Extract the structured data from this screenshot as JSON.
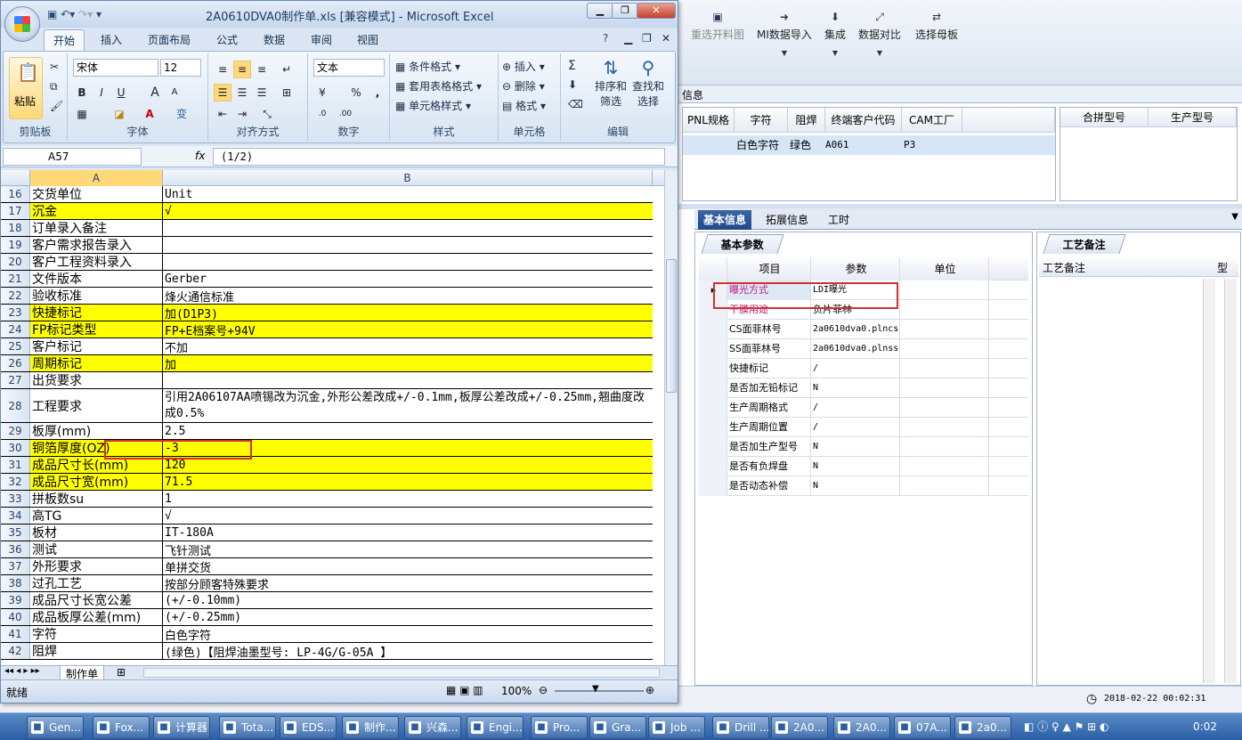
{
  "excel": {
    "title": "2A0610DVA0制作单.xls  [兼容模式] - Microsoft Excel",
    "tabs": [
      "开始",
      "插入",
      "页面布局",
      "公式",
      "数据",
      "审阅",
      "视图"
    ],
    "ribbon": {
      "paste": "粘贴",
      "clipboard": "剪贴板",
      "font_name": "宋体",
      "font_size": "12",
      "font": "字体",
      "bold": "B",
      "italic": "I",
      "underline": "U",
      "grow": "A",
      "shrink": "A",
      "wen": "变",
      "align": "对齐方式",
      "number_format": "文本",
      "number": "数字",
      "percent": "%",
      "comma": ",",
      "cond_format": "条件格式",
      "table_format": "套用表格格式",
      "cell_style": "单元格样式",
      "styles": "样式",
      "insert": "插入",
      "delete": "删除",
      "format": "格式",
      "cells": "单元格",
      "sum": "Σ",
      "sort": "排序和",
      "filter": "筛选",
      "find": "查找和",
      "select": "选择",
      "edit": "编辑"
    },
    "name_box": "A57",
    "fx": "fx",
    "formula": "(1/2)",
    "col_headers": [
      "A",
      "B"
    ],
    "rows": [
      {
        "n": "16",
        "a": "交货单位",
        "b": "Unit",
        "y": false
      },
      {
        "n": "17",
        "a": "沉金",
        "b": "√",
        "y": true
      },
      {
        "n": "18",
        "a": "订单录入备注",
        "b": "",
        "y": false
      },
      {
        "n": "19",
        "a": "客户需求报告录入",
        "b": "",
        "y": false
      },
      {
        "n": "20",
        "a": "客户工程资料录入",
        "b": "",
        "y": false
      },
      {
        "n": "21",
        "a": "文件版本",
        "b": "Gerber",
        "y": false
      },
      {
        "n": "22",
        "a": "验收标准",
        "b": "烽火通信标准",
        "y": false
      },
      {
        "n": "23",
        "a": "快捷标记",
        "b": "加(D1P3)",
        "y": true
      },
      {
        "n": "24",
        "a": "FP标记类型",
        "b": "FP+E档案号+94V",
        "y": true
      },
      {
        "n": "25",
        "a": "客户标记",
        "b": "不加",
        "y": false
      },
      {
        "n": "26",
        "a": "周期标记",
        "b": "加",
        "y": true
      },
      {
        "n": "27",
        "a": "出货要求",
        "b": "",
        "y": false
      },
      {
        "n": "28",
        "a": "工程要求",
        "b": "引用2A06107AA喷锡改为沉金,外形公差改成+/-0.1mm,板厚公差改成+/-0.25mm,翘曲度改成0.5%",
        "y": false,
        "tall": true
      },
      {
        "n": "29",
        "a": "板厚(mm)",
        "b": "2.5",
        "y": false
      },
      {
        "n": "30",
        "a": "铜箔厚度(OZ)",
        "b": "-3",
        "y": true
      },
      {
        "n": "31",
        "a": "成品尺寸长(mm)",
        "b": "120",
        "y": true
      },
      {
        "n": "32",
        "a": "成品尺寸宽(mm)",
        "b": "71.5",
        "y": true
      },
      {
        "n": "33",
        "a": "拼板数su",
        "b": "1",
        "y": false
      },
      {
        "n": "34",
        "a": "高TG",
        "b": "√",
        "y": false
      },
      {
        "n": "35",
        "a": "板材",
        "b": "IT-180A",
        "y": false
      },
      {
        "n": "36",
        "a": "测试",
        "b": "飞针测试",
        "y": false
      },
      {
        "n": "37",
        "a": "外形要求",
        "b": "单拼交货",
        "y": false
      },
      {
        "n": "38",
        "a": "过孔工艺",
        "b": "按部分顾客特殊要求",
        "y": false
      },
      {
        "n": "39",
        "a": "成品尺寸长宽公差",
        "b": "(+/-0.10mm)",
        "y": false
      },
      {
        "n": "40",
        "a": "成品板厚公差(mm)",
        "b": "(+/-0.25mm)",
        "y": false
      },
      {
        "n": "41",
        "a": "字符",
        "b": "白色字符",
        "y": false
      },
      {
        "n": "42",
        "a": "阻焊",
        "b": "(绿色)【阻焊油墨型号: LP-4G/G-05A 】",
        "y": false
      }
    ],
    "sheet_tab": "制作单",
    "status": "就绪",
    "zoom": "100%"
  },
  "cam": {
    "toolbar": [
      {
        "label": "重选开料图",
        "disabled": true
      },
      {
        "label": "MI数据导入",
        "disabled": false
      },
      {
        "label": "集成",
        "disabled": false
      },
      {
        "label": "数据对比",
        "disabled": false
      },
      {
        "label": "选择母板",
        "disabled": false
      }
    ],
    "info_label": "信息",
    "grid_headers": [
      "PNL规格",
      "字符",
      "阻焊",
      "终端客户代码",
      "CAM工厂"
    ],
    "grid_row": [
      "",
      "白色字符",
      "绿色",
      "A061",
      "P3"
    ],
    "grid2_headers": [
      "合拼型号",
      "生产型号"
    ],
    "tabs": [
      "基本信息",
      "拓展信息",
      "工时"
    ],
    "panel_tab": "基本参数",
    "param_headers": [
      "项目",
      "参数",
      "单位"
    ],
    "params": [
      {
        "item": "曝光方式",
        "value": "LDI曝光"
      },
      {
        "item": "干膜用途",
        "value": "负片菲林"
      },
      {
        "item": "CS面菲林号",
        "value": "2a0610dva0.plncs"
      },
      {
        "item": "SS面菲林号",
        "value": "2a0610dva0.plnss"
      },
      {
        "item": "快捷标记",
        "value": "/"
      },
      {
        "item": "是否加无铅标记",
        "value": "N"
      },
      {
        "item": "生产周期格式",
        "value": "/"
      },
      {
        "item": "生产周期位置",
        "value": "/"
      },
      {
        "item": "是否加生产型号",
        "value": "N"
      },
      {
        "item": "是否有负焊盘",
        "value": "N"
      },
      {
        "item": "是否动态补偿",
        "value": "N"
      }
    ],
    "craft_tab": "工艺备注",
    "craft_header": "工艺备注",
    "craft_header2": "型",
    "datetime": "2018-02-22 00:02:31"
  },
  "taskbar": {
    "items": [
      "Gen...",
      "Fox...",
      "计算器",
      "Tota...",
      "EDS...",
      "制作...",
      "兴森...",
      "Engi...",
      "Pro...",
      "Gra...",
      "Job ...",
      "Drill ...",
      "2A0...",
      "2A0...",
      "07A...",
      "2a0..."
    ],
    "clock": "0:02"
  }
}
